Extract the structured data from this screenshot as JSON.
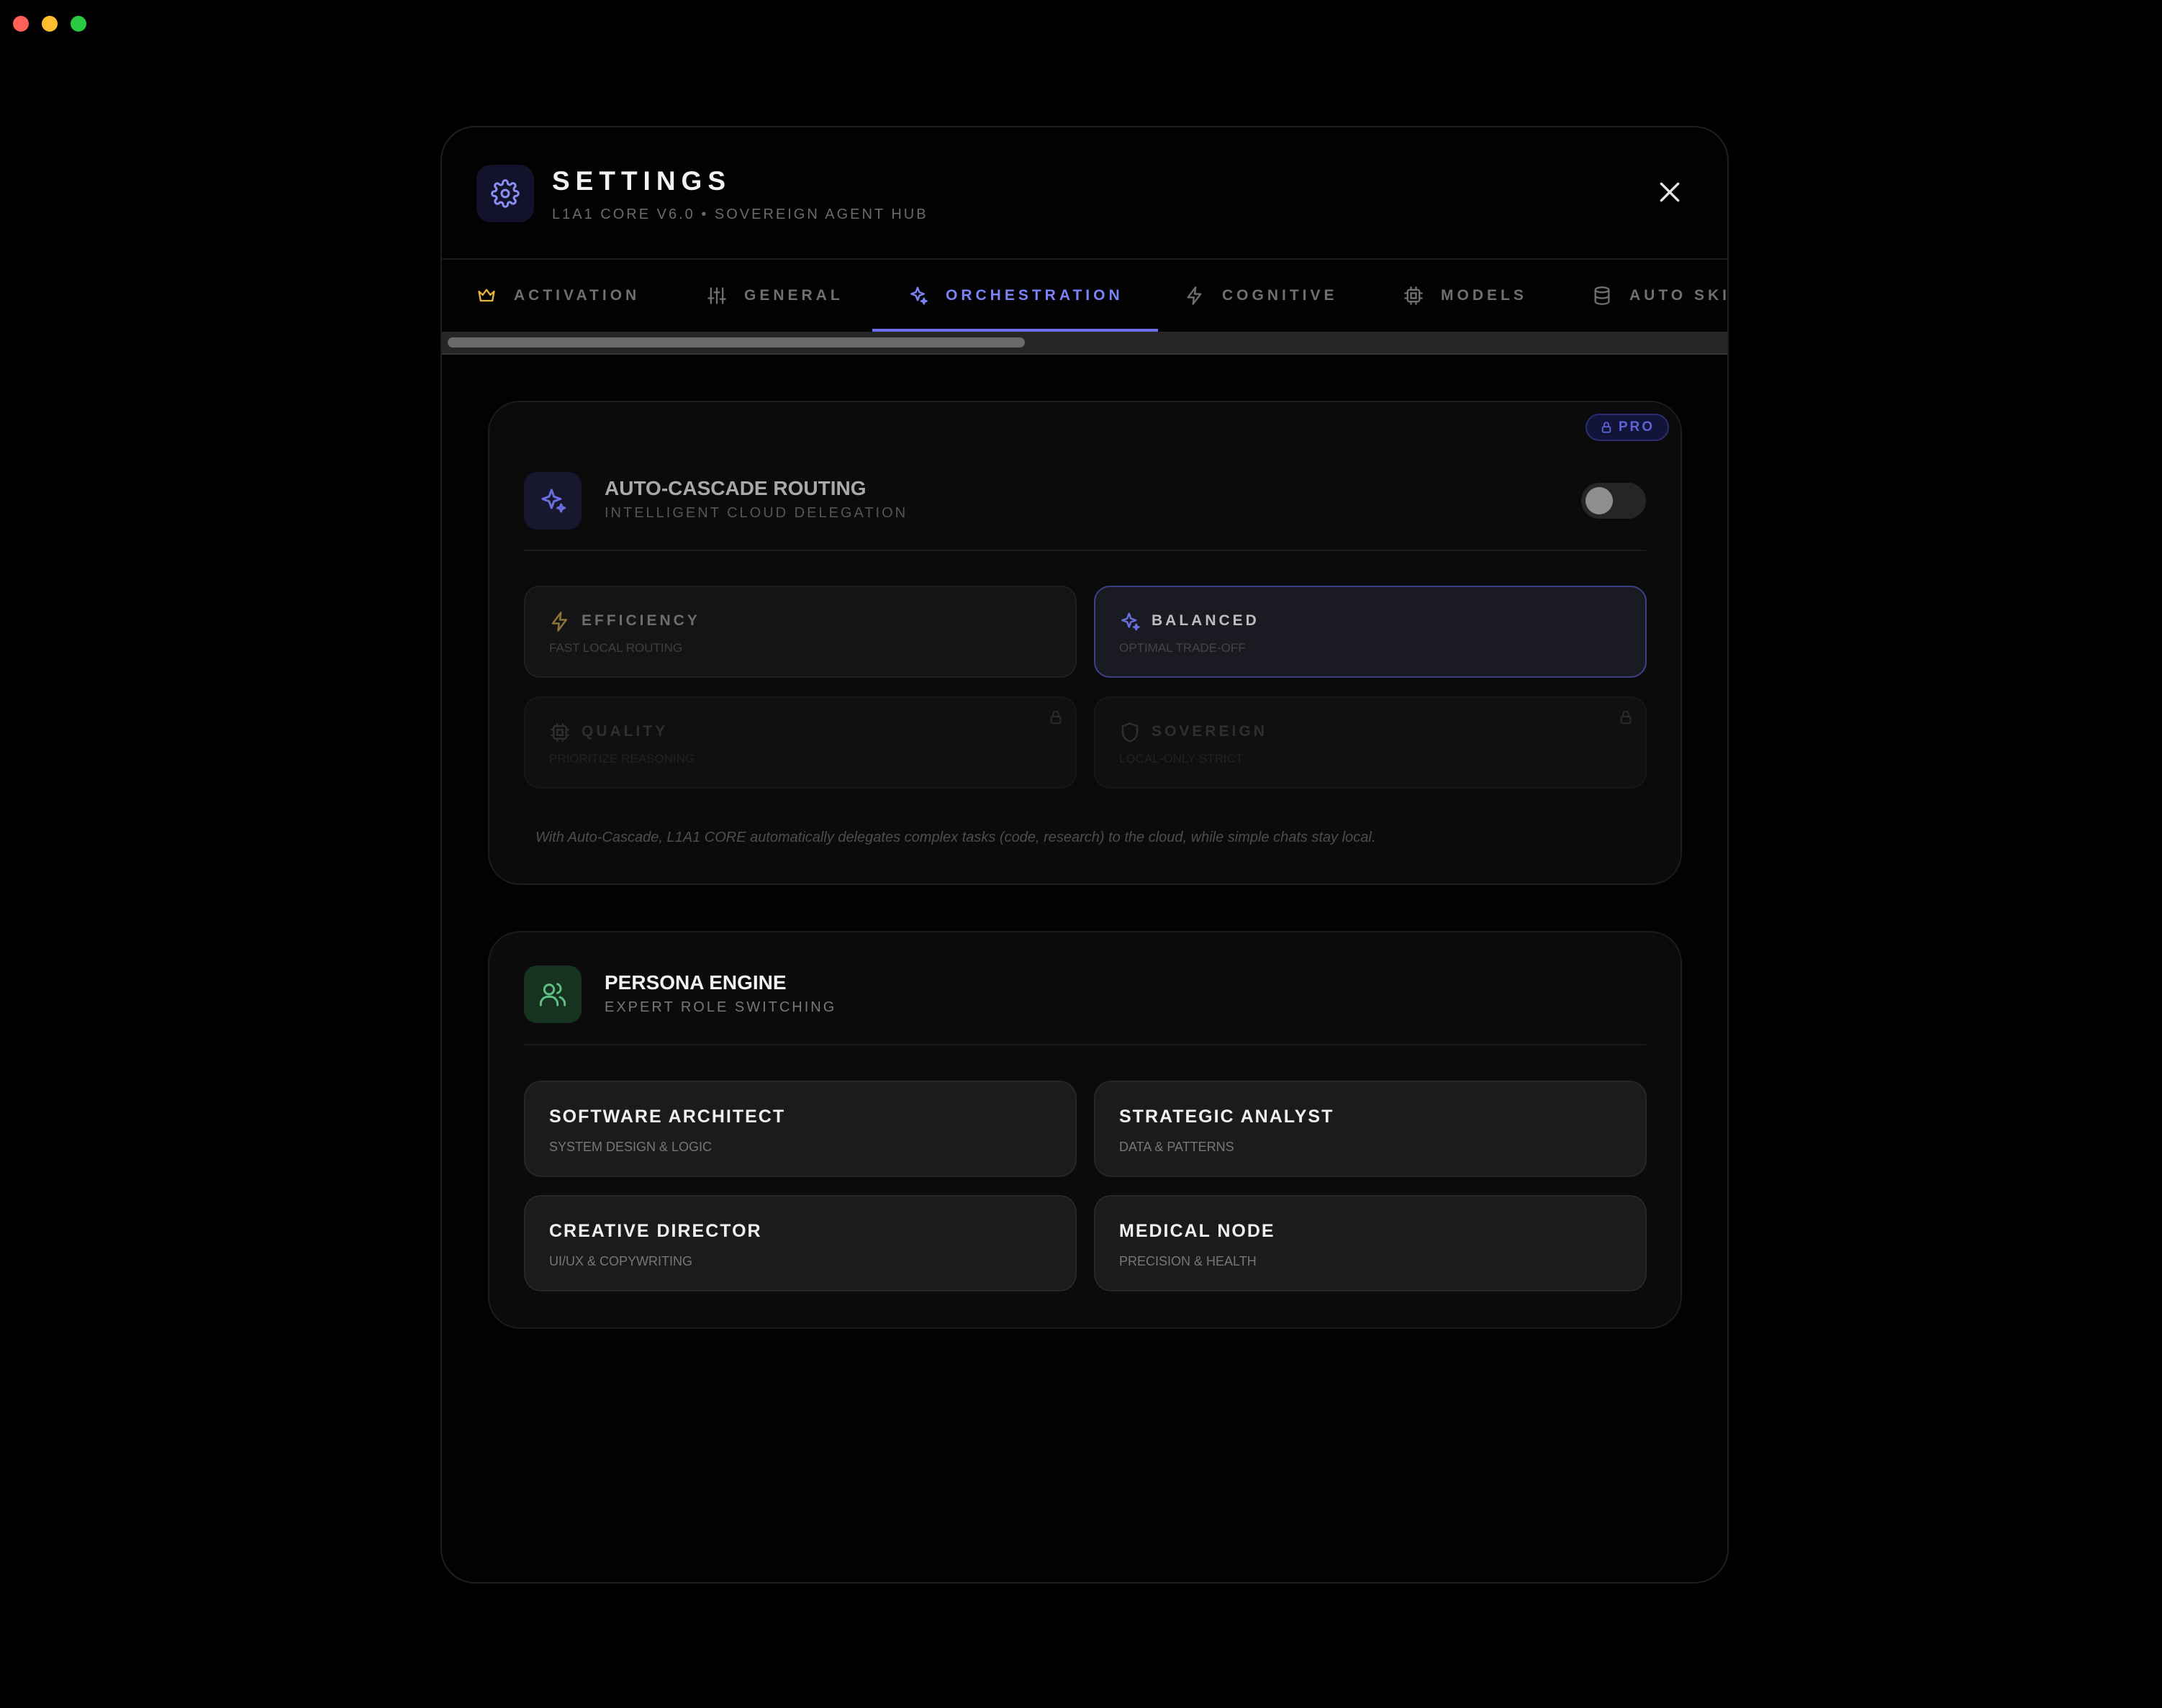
{
  "header": {
    "title": "SETTINGS",
    "subtitle": "L1A1 CORE V6.0 • SOVEREIGN AGENT HUB"
  },
  "tabs": [
    {
      "label": "ACTIVATION",
      "icon": "crown-icon"
    },
    {
      "label": "GENERAL",
      "icon": "sliders-icon"
    },
    {
      "label": "ORCHESTRATION",
      "icon": "sparkles-icon",
      "active": true
    },
    {
      "label": "COGNITIVE",
      "icon": "zap-icon"
    },
    {
      "label": "MODELS",
      "icon": "cpu-icon"
    },
    {
      "label": "AUTO SKI",
      "icon": "database-icon"
    }
  ],
  "cascade": {
    "badge": "PRO",
    "title": "AUTO-CASCADE ROUTING",
    "subtitle": "INTELLIGENT CLOUD DELEGATION",
    "enabled": false,
    "options": [
      {
        "title": "EFFICIENCY",
        "sub": "FAST LOCAL ROUTING",
        "icon": "zap-icon",
        "state": "normal"
      },
      {
        "title": "BALANCED",
        "sub": "OPTIMAL TRADE-OFF",
        "icon": "sparkles-icon",
        "state": "selected"
      },
      {
        "title": "QUALITY",
        "sub": "PRIORITIZE REASONING",
        "icon": "cpu-icon",
        "state": "locked"
      },
      {
        "title": "SOVEREIGN",
        "sub": "LOCAL-ONLY STRICT",
        "icon": "shield-icon",
        "state": "locked"
      }
    ],
    "note": "With Auto-Cascade, L1A1 CORE automatically delegates complex tasks (code, research) to the cloud, while simple chats stay local."
  },
  "persona": {
    "title": "PERSONA ENGINE",
    "subtitle": "EXPERT ROLE SWITCHING",
    "roles": [
      {
        "title": "SOFTWARE ARCHITECT",
        "sub": "SYSTEM DESIGN & LOGIC"
      },
      {
        "title": "STRATEGIC ANALYST",
        "sub": "DATA & PATTERNS"
      },
      {
        "title": "CREATIVE DIRECTOR",
        "sub": "UI/UX & COPYWRITING"
      },
      {
        "title": "MEDICAL NODE",
        "sub": "PRECISION & HEALTH"
      }
    ]
  },
  "colors": {
    "accent": "#7c82f7",
    "activation_gold": "#e8b43a",
    "persona_green": "#5fbf7f",
    "background": "#000000"
  }
}
